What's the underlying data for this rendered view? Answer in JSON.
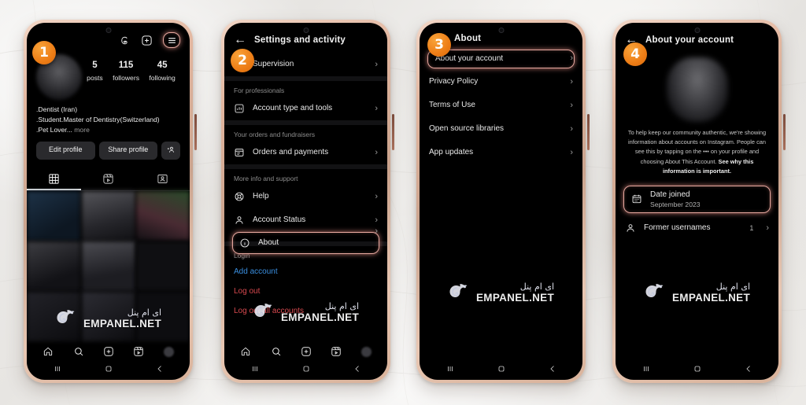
{
  "background": {
    "surface": "marble-white",
    "accent_badge": "#ed7d16",
    "highlight": "#e8a9a0"
  },
  "watermark": {
    "persian": "ای ام پنل",
    "latin": "EMPANEL.NET",
    "icon": "eagle-logo-icon"
  },
  "android_nav": {
    "recents": "recents-icon",
    "home": "home-square-icon",
    "back": "back-chevron-icon"
  },
  "phones": [
    {
      "step": "1",
      "screen": "instagram-profile",
      "topbar": [
        {
          "name": "threads-icon",
          "label": "Threads"
        },
        {
          "name": "add-icon",
          "label": "New post"
        },
        {
          "name": "hamburger-menu-icon",
          "label": "Menu",
          "highlighted": true
        }
      ],
      "stats": [
        {
          "value": "5",
          "label": "posts"
        },
        {
          "value": "115",
          "label": "followers"
        },
        {
          "value": "45",
          "label": "following"
        }
      ],
      "bio": [
        ".Dentist (Iran)",
        ".Student.Master of Dentistry(Switzerland)",
        ".Pet Lover..."
      ],
      "bio_more": "more",
      "buttons": [
        "Edit profile",
        "Share profile"
      ],
      "add_person_button": "add-person-icon",
      "tabs": [
        "grid-tab",
        "reels-tab",
        "tagged-tab"
      ],
      "bottom_nav": [
        "home-icon",
        "search-icon",
        "create-icon",
        "reels-icon",
        "profile-avatar"
      ]
    },
    {
      "step": "2",
      "screen": "settings-and-activity",
      "title": "Settings and activity",
      "back": "back-arrow-icon",
      "items": [
        {
          "label": "Supervision",
          "icon": "supervision-icon",
          "chevron": true
        },
        {
          "section": "For professionals"
        },
        {
          "label": "Account type and tools",
          "icon": "chart-box-icon",
          "chevron": true
        },
        {
          "section": "Your orders and fundraisers"
        },
        {
          "label": "Orders and payments",
          "icon": "orders-icon",
          "chevron": true
        },
        {
          "section": "More info and support"
        },
        {
          "label": "Help",
          "icon": "help-icon",
          "chevron": true
        },
        {
          "label": "Account Status",
          "icon": "person-icon",
          "chevron": true
        },
        {
          "label": "About",
          "icon": "info-icon",
          "chevron": true,
          "highlighted": true
        },
        {
          "section": "Login"
        }
      ],
      "login_links": [
        {
          "label": "Add account",
          "color": "blue"
        },
        {
          "label": "Log out",
          "color": "red"
        },
        {
          "label": "Log out all accounts",
          "color": "red"
        }
      ],
      "bottom_nav": [
        "home-icon",
        "search-icon",
        "create-icon",
        "reels-icon",
        "profile-avatar"
      ]
    },
    {
      "step": "3",
      "screen": "about",
      "title": "About",
      "items": [
        {
          "label": "About your account",
          "chevron": true,
          "highlighted": true
        },
        {
          "label": "Privacy Policy",
          "chevron": true
        },
        {
          "label": "Terms of Use",
          "chevron": true
        },
        {
          "label": "Open source libraries",
          "chevron": true
        },
        {
          "label": "App updates",
          "chevron": true
        }
      ]
    },
    {
      "step": "4",
      "screen": "about-your-account",
      "title": "About your account",
      "back": "back-arrow-icon",
      "avatar": "blurred-profile-photo",
      "disclaimer": "To help keep our community authentic, we're showing information about accounts on Instagram. People can see this by tapping on the ••• on your profile and choosing About This Account.",
      "disclaimer_link": "See why this information is important.",
      "items": [
        {
          "label": "Date joined",
          "sub": "September 2023",
          "icon": "calendar-icon",
          "highlighted": true
        },
        {
          "label": "Former usernames",
          "icon": "person-icon",
          "count": "1",
          "chevron": true
        }
      ]
    }
  ]
}
